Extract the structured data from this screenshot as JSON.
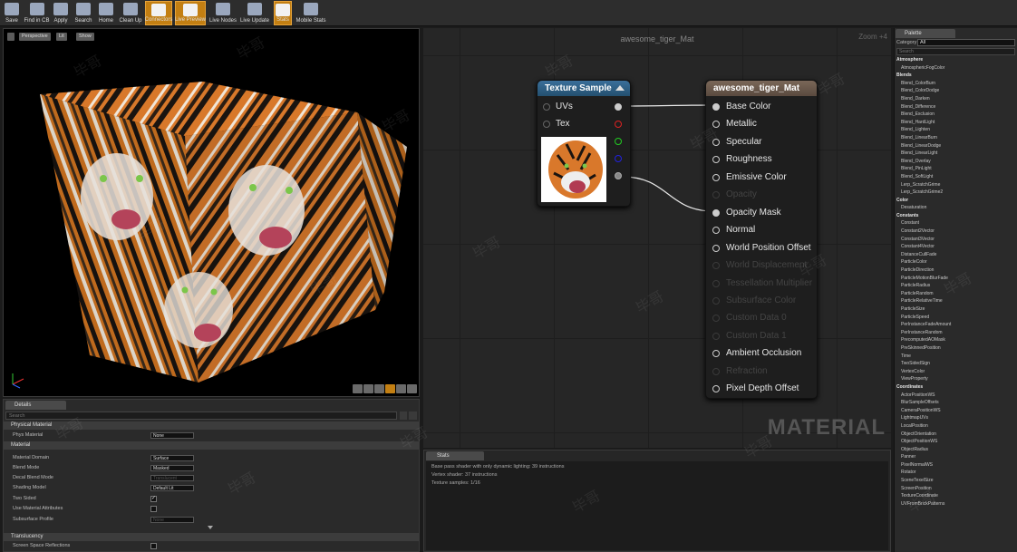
{
  "toolbar": {
    "buttons": [
      {
        "label": "Save",
        "icon": "save-icon"
      },
      {
        "label": "Find in CB",
        "icon": "magnifier-icon"
      },
      {
        "label": "Apply",
        "icon": "checkmark-icon"
      },
      {
        "label": "Search",
        "icon": "binoculars-icon"
      },
      {
        "label": "Home",
        "icon": "home-icon"
      },
      {
        "label": "Clean Up",
        "icon": "broom-icon"
      },
      {
        "label": "Connectors",
        "icon": "connectors-icon",
        "active": true
      },
      {
        "label": "Live Preview",
        "icon": "preview-icon",
        "active": true
      },
      {
        "label": "Live Nodes",
        "icon": "nodes-icon"
      },
      {
        "label": "Live Update",
        "icon": "refresh-icon"
      },
      {
        "label": "Stats",
        "icon": "stats-icon",
        "active": true
      },
      {
        "label": "Mobile Stats",
        "icon": "mobile-stats-icon"
      }
    ]
  },
  "viewport": {
    "buttons": [
      "Perspective",
      "Lit",
      "Show"
    ]
  },
  "details": {
    "tab": "Details",
    "search_placeholder": "Search",
    "categories": {
      "physical": "Physical Material",
      "material": "Material",
      "translucency": "Translucency"
    },
    "rows": [
      {
        "label": "Phys Material",
        "value": "None",
        "kind": "select"
      },
      {
        "label": "Material Domain",
        "value": "Surface",
        "kind": "select"
      },
      {
        "label": "Blend Mode",
        "value": "Masked",
        "kind": "select"
      },
      {
        "label": "Decal Blend Mode",
        "value": "Translucent",
        "kind": "select",
        "disabled": true
      },
      {
        "label": "Shading Model",
        "value": "Default Lit",
        "kind": "select"
      },
      {
        "label": "Two Sided",
        "value": "✓",
        "kind": "check"
      },
      {
        "label": "Use Material Attributes",
        "value": "",
        "kind": "check"
      },
      {
        "label": "Subsurface Profile",
        "value": "None",
        "kind": "select",
        "disabled": true
      },
      {
        "label": "Screen Space Reflections",
        "value": "",
        "kind": "check"
      }
    ]
  },
  "graph": {
    "title": "awesome_tiger_Mat",
    "zoom": "Zoom +4",
    "watermark": "MATERIAL",
    "texture_node": {
      "title": "Texture Sample",
      "inputs": [
        "UVs",
        "Tex"
      ]
    },
    "material_node": {
      "title": "awesome_tiger_Mat",
      "pins": [
        {
          "label": "Base Color",
          "state": "connected"
        },
        {
          "label": "Metallic",
          "state": "on"
        },
        {
          "label": "Specular",
          "state": "on"
        },
        {
          "label": "Roughness",
          "state": "on"
        },
        {
          "label": "Emissive Color",
          "state": "on"
        },
        {
          "label": "Opacity",
          "state": "disabled"
        },
        {
          "label": "Opacity Mask",
          "state": "connected"
        },
        {
          "label": "Normal",
          "state": "on"
        },
        {
          "label": "World Position Offset",
          "state": "on"
        },
        {
          "label": "World Displacement",
          "state": "disabled"
        },
        {
          "label": "Tessellation Multiplier",
          "state": "disabled"
        },
        {
          "label": "Subsurface Color",
          "state": "disabled"
        },
        {
          "label": "Custom Data 0",
          "state": "disabled"
        },
        {
          "label": "Custom Data 1",
          "state": "disabled"
        },
        {
          "label": "Ambient Occlusion",
          "state": "on"
        },
        {
          "label": "Refraction",
          "state": "disabled"
        },
        {
          "label": "Pixel Depth Offset",
          "state": "on"
        }
      ]
    }
  },
  "stats": {
    "tab": "Stats",
    "lines": [
      "Base pass shader with only dynamic lighting: 39 instructions",
      "Vertex shader: 37 instructions",
      "Texture samples: 1/16"
    ]
  },
  "palette": {
    "tab": "Palette",
    "category_label": "Category",
    "category_value": "All",
    "search_placeholder": "Search",
    "items": [
      {
        "t": "Atmosphere",
        "c": 1
      },
      {
        "t": "AtmosphericFogColor"
      },
      {
        "t": "Blends",
        "c": 1
      },
      {
        "t": "Blend_ColorBurn"
      },
      {
        "t": "Blend_ColorDodge"
      },
      {
        "t": "Blend_Darken"
      },
      {
        "t": "Blend_Difference"
      },
      {
        "t": "Blend_Exclusion"
      },
      {
        "t": "Blend_HardLight"
      },
      {
        "t": "Blend_Lighten"
      },
      {
        "t": "Blend_LinearBurn"
      },
      {
        "t": "Blend_LinearDodge"
      },
      {
        "t": "Blend_LinearLight"
      },
      {
        "t": "Blend_Overlay"
      },
      {
        "t": "Blend_PinLight"
      },
      {
        "t": "Blend_SoftLight"
      },
      {
        "t": "Lerp_ScratchGrime"
      },
      {
        "t": "Lerp_ScratchGrime2"
      },
      {
        "t": "Color",
        "c": 1
      },
      {
        "t": "Desaturation"
      },
      {
        "t": "Constants",
        "c": 1
      },
      {
        "t": "Constant"
      },
      {
        "t": "Constant2Vector"
      },
      {
        "t": "Constant3Vector"
      },
      {
        "t": "Constant4Vector"
      },
      {
        "t": "DistanceCullFade"
      },
      {
        "t": "ParticleColor"
      },
      {
        "t": "ParticleDirection"
      },
      {
        "t": "ParticleMotionBlurFade"
      },
      {
        "t": "ParticleRadius"
      },
      {
        "t": "ParticleRandom"
      },
      {
        "t": "ParticleRelativeTime"
      },
      {
        "t": "ParticleSize"
      },
      {
        "t": "ParticleSpeed"
      },
      {
        "t": "PerInstanceFadeAmount"
      },
      {
        "t": "PerInstanceRandom"
      },
      {
        "t": "PrecomputedAOMask"
      },
      {
        "t": "PreSkinnedPosition"
      },
      {
        "t": "Time"
      },
      {
        "t": "TwoSidedSign"
      },
      {
        "t": "VertexColor"
      },
      {
        "t": "ViewProperty"
      },
      {
        "t": "Coordinates",
        "c": 1
      },
      {
        "t": "ActorPositionWS"
      },
      {
        "t": "BlurSampleOffsets"
      },
      {
        "t": "CameraPositionWS"
      },
      {
        "t": "LightmapUVs"
      },
      {
        "t": "LocalPosition"
      },
      {
        "t": "ObjectOrientation"
      },
      {
        "t": "ObjectPositionWS"
      },
      {
        "t": "ObjectRadius"
      },
      {
        "t": "Panner"
      },
      {
        "t": "PixelNormalWS"
      },
      {
        "t": "Rotator"
      },
      {
        "t": "SceneTexelSize"
      },
      {
        "t": "ScreenPosition"
      },
      {
        "t": "TextureCoordinate"
      },
      {
        "t": "UVFromBrickPatterns"
      }
    ]
  },
  "watermark": "毕哥"
}
